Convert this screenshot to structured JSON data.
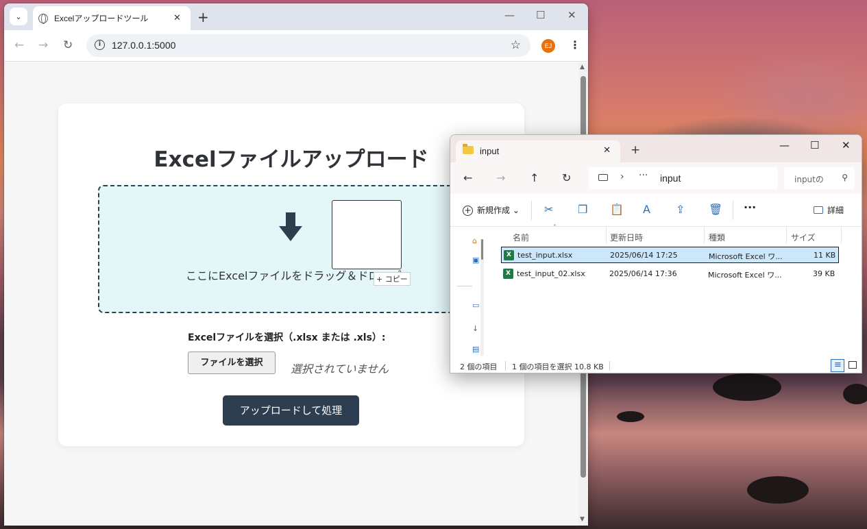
{
  "browser": {
    "tab_title": "Excelアップロードツール",
    "url": "127.0.0.1:5000",
    "avatar_initials": "EJ"
  },
  "page": {
    "heading": "Excelファイルアップロード",
    "dropzone_text": "ここにExcelファイルをドラッグ＆ドロップ",
    "drag_copy_label": "+ コピー",
    "file_label": "Excelファイルを選択（.xlsx または .xls）:",
    "file_button": "ファイルを選択",
    "file_status": "選択されていません",
    "upload_button": "アップロードして処理"
  },
  "explorer": {
    "tab_title": "input",
    "address_path": "input",
    "search_placeholder": "inputの",
    "new_button": "新規作成",
    "details_button": "詳細",
    "columns": [
      "名前",
      "更新日時",
      "種類",
      "サイズ"
    ],
    "files": [
      {
        "name": "test_input.xlsx",
        "modified": "2025/06/14 17:25",
        "type": "Microsoft Excel ワ...",
        "size": "11 KB",
        "selected": true
      },
      {
        "name": "test_input_02.xlsx",
        "modified": "2025/06/14 17:36",
        "type": "Microsoft Excel ワ...",
        "size": "39 KB",
        "selected": false
      }
    ],
    "status_count": "2 個の項目",
    "status_selection": "1 個の項目を選択  10.8 KB"
  },
  "colors": {
    "accent_dark": "#2d3e50",
    "dropzone_bg": "#e3f6f8",
    "selection_bg": "#cce6fa",
    "excel_green": "#1f7a45"
  }
}
